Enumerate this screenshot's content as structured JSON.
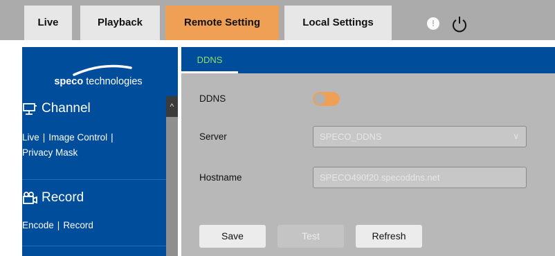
{
  "nav": {
    "tabs": [
      {
        "label": "Live"
      },
      {
        "label": "Playback"
      },
      {
        "label": "Remote Setting"
      },
      {
        "label": "Local Settings"
      }
    ],
    "active_tab": "Remote Setting",
    "alert_glyph": "!"
  },
  "sidebar": {
    "logo": {
      "brand": "speco",
      "suffix": " technologies"
    },
    "channel": {
      "title": "Channel",
      "icon": "monitor-icon",
      "links": [
        "Live",
        "Image Control",
        "Privacy Mask"
      ]
    },
    "record": {
      "title": "Record",
      "icon": "record-icon",
      "links": [
        "Encode",
        "Record"
      ]
    },
    "separator": "|",
    "scroll_up_glyph": "^"
  },
  "main": {
    "tab": "DDNS",
    "fields": {
      "ddns_label": "DDNS",
      "ddns_enabled": false,
      "server_label": "Server",
      "server_value": "SPECO_DDNS",
      "hostname_label": "Hostname",
      "hostname_value": "SPECO490f20.specoddns.net"
    },
    "buttons": {
      "save": "Save",
      "test": "Test",
      "refresh": "Refresh"
    }
  },
  "colors": {
    "active_tab": "#f0a054",
    "brand_blue": "#004d9b",
    "tab_text_green": "#8fe06b"
  }
}
